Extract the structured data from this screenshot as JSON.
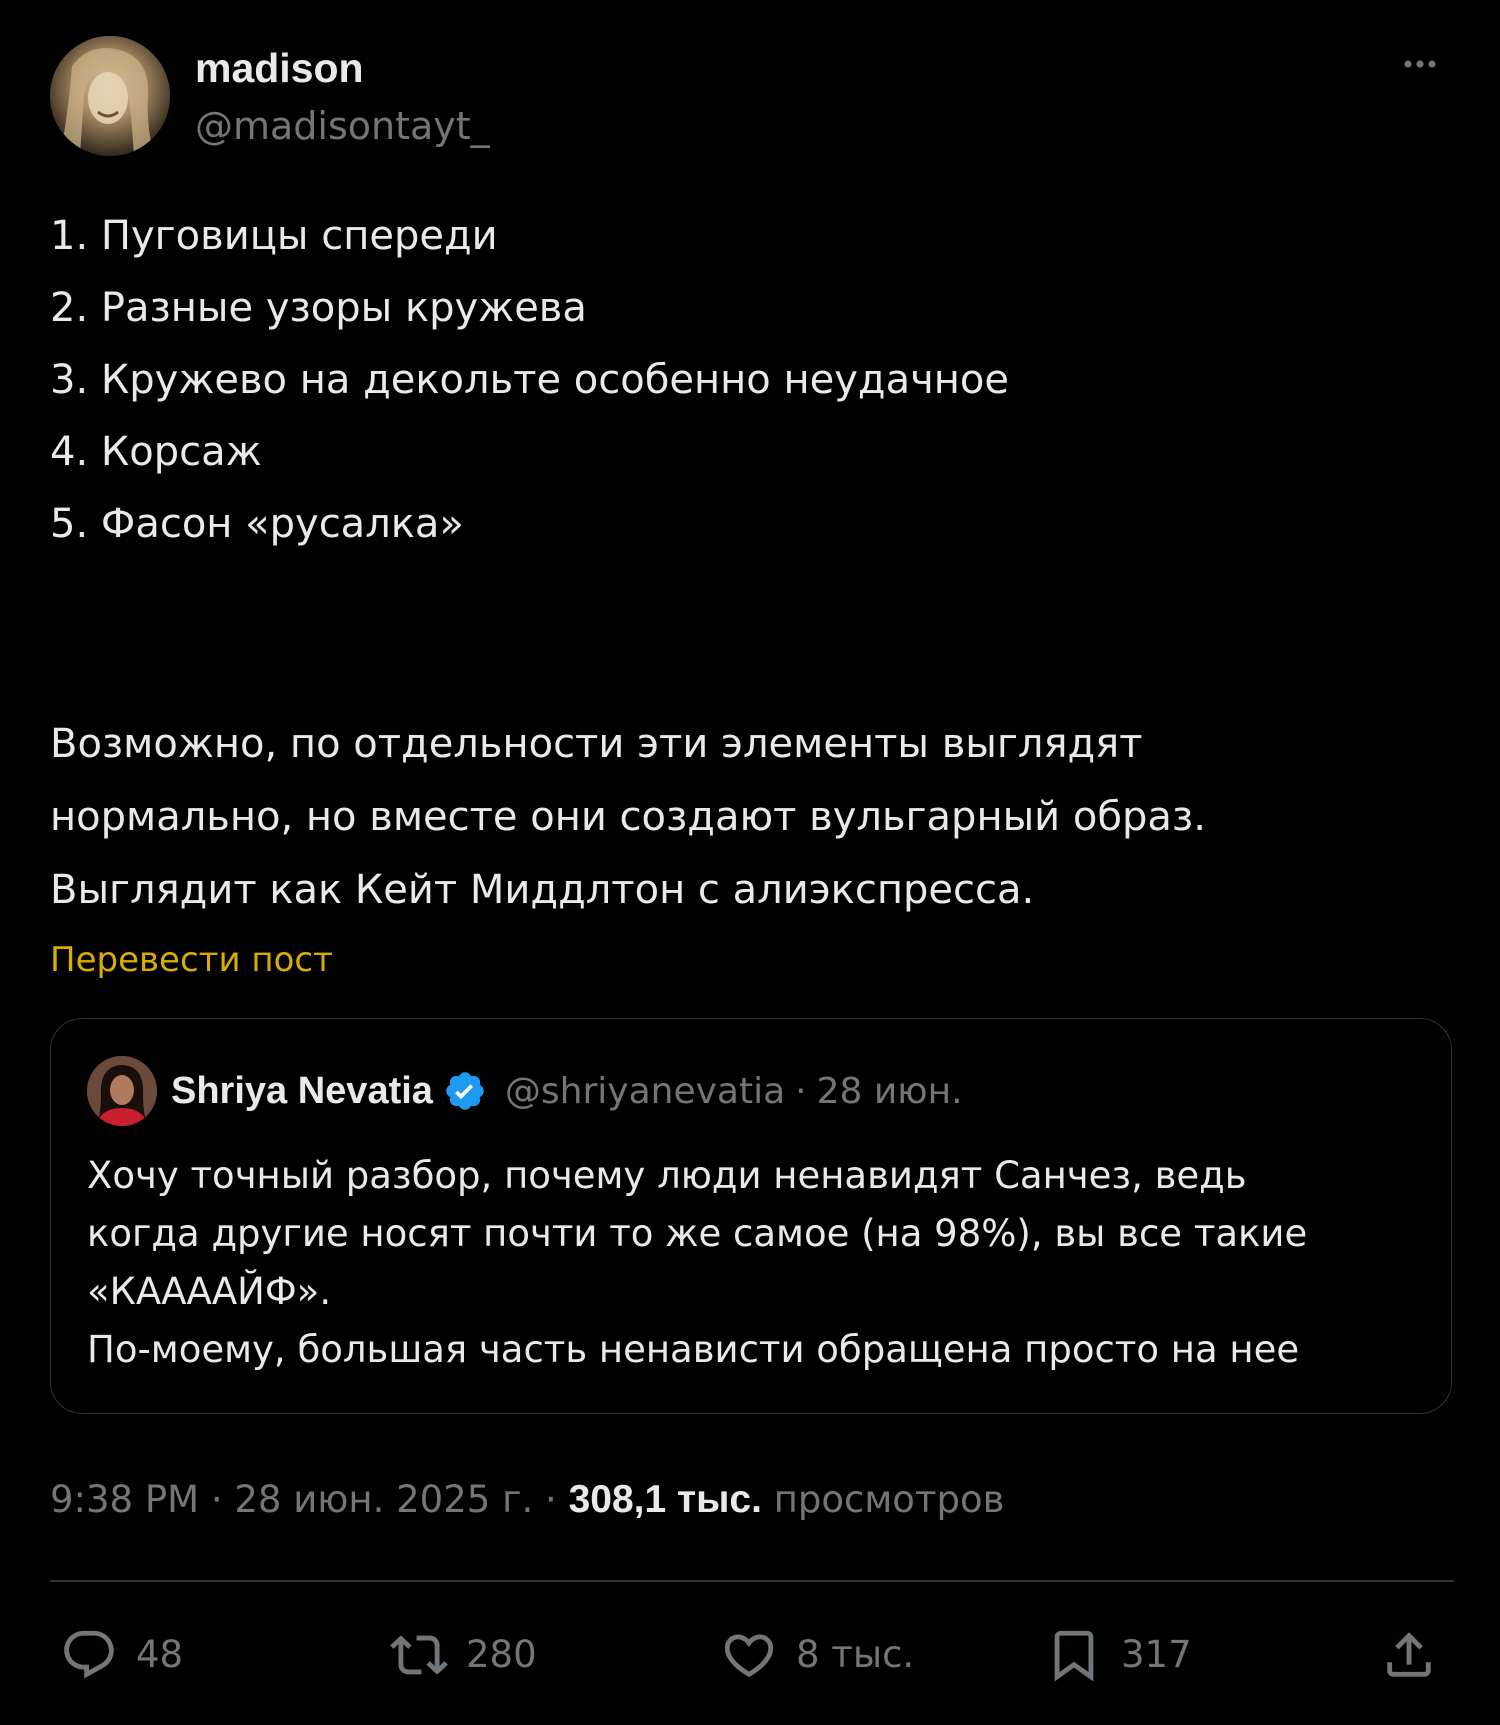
{
  "author": {
    "display_name": "madison",
    "handle": "@madisontayt_"
  },
  "post": {
    "list": [
      "1. Пуговицы спереди",
      "2. Разные узоры кружева",
      "3. Кружево на декольте особенно неудачное",
      "4. Корсаж",
      "5. Фасон «русалка»"
    ],
    "paragraph": [
      "Возможно, по отдельности эти элементы выглядят",
      "нормально, но вместе они создают вульгарный образ.",
      "Выглядит как Кейт Миддлтон с алиэкспресса."
    ],
    "translate_label": "Перевести пост"
  },
  "quote": {
    "display_name": "Shriya Nevatia",
    "handle": "@shriyanevatia",
    "separator": "·",
    "date": "28 июн.",
    "lines": [
      "Хочу точный разбор, почему люди ненавидят Санчез, ведь",
      "когда другие носят почти то же самое (на 98%), вы все такие",
      "«КААААЙФ».",
      "По-моему, большая часть ненависти обращена просто на нее"
    ]
  },
  "meta": {
    "time": "9:38 PM",
    "separator": "·",
    "date": "28 июн. 2025 г.",
    "views_count": "308,1 тыс.",
    "views_label": "просмотров"
  },
  "actions": {
    "replies": "48",
    "reposts": "280",
    "likes": "8 тыс.",
    "bookmarks": "317"
  },
  "icons": {
    "more": "more-horizontal-icon",
    "verified": "verified-badge-icon",
    "reply": "reply-icon",
    "repost": "repost-icon",
    "like": "heart-icon",
    "bookmark": "bookmark-icon",
    "share": "share-icon"
  },
  "colors": {
    "background": "#000000",
    "text_primary": "#e7e9ea",
    "text_secondary": "#71767b",
    "translate_link": "#d9ad00",
    "verified_blue": "#1d9bf0",
    "border": "#2f3336"
  }
}
